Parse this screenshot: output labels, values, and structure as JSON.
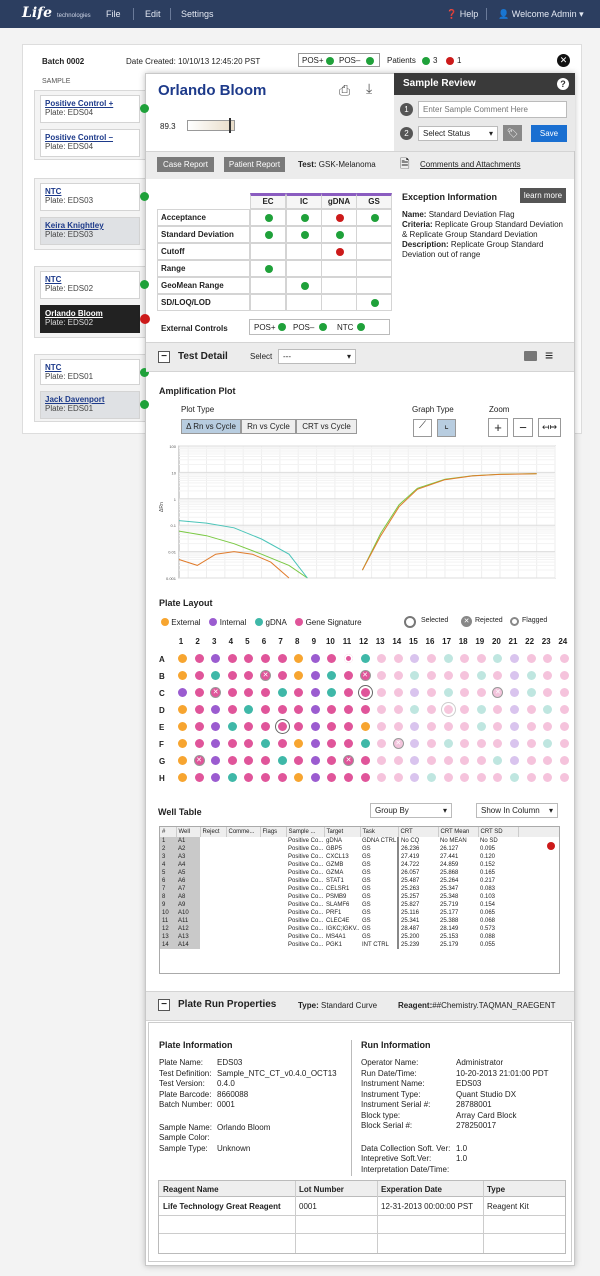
{
  "topbar": {
    "logo": "Life",
    "logo_small": "technologies",
    "menu": [
      "File",
      "Edit",
      "Settings"
    ],
    "help": "Help",
    "user": "Welcome Admin"
  },
  "batch": {
    "title": "Batch 0002",
    "date": "Date Created: 10/10/13 12:45:20 PST",
    "pos_plus": "POS+",
    "pos_minus": "POS–",
    "patients_label": "Patients",
    "patients_green": "3",
    "patients_red": "1",
    "sample_label": "SAMPLE"
  },
  "samples": [
    {
      "name": "Positive Control +",
      "plate": "Plate: EDS04"
    },
    {
      "name": "Positive Control –",
      "plate": "Plate: EDS04"
    },
    {
      "name": "NTC",
      "plate": "Plate: EDS03"
    },
    {
      "name": "Keira Knightley",
      "plate": "Plate: EDS03"
    },
    {
      "name": "NTC",
      "plate": "Plate: EDS02"
    },
    {
      "name": "Orlando Bloom",
      "plate": "Plate: EDS02"
    },
    {
      "name": "NTC",
      "plate": "Plate: EDS01"
    },
    {
      "name": "Jack Davenport",
      "plate": "Plate: EDS01"
    }
  ],
  "patient": {
    "name": "Orlando Bloom",
    "score": "89.3",
    "score_level": 0.9,
    "case_report": "Case Report",
    "patient_report": "Patient Report",
    "test_label": "Test:",
    "test_value": "GSK-Melanoma",
    "comments": "Comments and Attachments"
  },
  "review": {
    "title": "Sample Review",
    "comment_placeholder": "Enter Sample Comment Here",
    "status": "Select Status",
    "save": "Save",
    "step1": "1",
    "step2": "2"
  },
  "qc": {
    "cols": [
      "EC",
      "IC",
      "gDNA",
      "GS"
    ],
    "rows": [
      "Acceptance",
      "Standard Deviation",
      "Cutoff",
      "Range",
      "GeoMean Range",
      "SD/LOQ/LOD"
    ],
    "dots": [
      [
        "g",
        "g",
        "r",
        "g"
      ],
      [
        "g",
        "g",
        "g",
        ""
      ],
      [
        "",
        "",
        "r",
        ""
      ],
      [
        "g",
        "",
        "",
        ""
      ],
      [
        "",
        "g",
        "",
        ""
      ],
      [
        "",
        "",
        "",
        "g"
      ]
    ],
    "external_label": "External Controls",
    "ext": [
      "POS+",
      "POS–",
      "NTC"
    ]
  },
  "exception": {
    "title": "Exception Information",
    "learn": "learn more",
    "name_k": "Name:",
    "name_v": "Standard Deviation Flag",
    "criteria_k": "Criteria:",
    "criteria_v": "Replicate Group Standard Deviation & Replicate Group Standard Deviation",
    "desc_k": "Description:",
    "desc_v": "Replicate Group Standard Deviation out of range"
  },
  "test_detail": {
    "title": "Test Detail",
    "select_label": "Select",
    "select_value": "---"
  },
  "amp": {
    "title": "Amplification Plot",
    "plot_type": "Plot Type",
    "types": [
      "Δ Rn vs Cycle",
      "Rn vs Cycle",
      "CRT vs Cycle"
    ],
    "graph_type": "Graph Type",
    "zoom": "Zoom",
    "ylabel": "ΔRn",
    "yticks": [
      "100",
      "10",
      "1",
      "0.1",
      "0.01",
      "0.001"
    ]
  },
  "chart_data": {
    "type": "line",
    "title": "",
    "xlabel": "",
    "ylabel": "ΔRn",
    "yscale": "log",
    "ylim": [
      0.001,
      100
    ],
    "series": [
      {
        "color": "#e07b2b",
        "x": [
          1,
          3,
          5,
          7,
          9,
          11,
          13
        ],
        "y": [
          0.005,
          0.003,
          0.008,
          0.01,
          0.008,
          0.004,
          0.001
        ]
      },
      {
        "color": "#7ac943",
        "x": [
          1,
          4,
          7,
          10,
          13,
          15
        ],
        "y": [
          0.06,
          0.04,
          0.02,
          0.008,
          0.003,
          0.001
        ]
      },
      {
        "color": "#4ac4b8",
        "x": [
          1,
          4,
          7,
          10,
          13,
          15
        ],
        "y": [
          0.15,
          0.12,
          0.08,
          0.03,
          0.008,
          0.001
        ]
      },
      {
        "color": "#7ac943",
        "x": [
          21,
          23,
          25,
          27,
          30,
          33,
          36,
          40
        ],
        "y": [
          0.002,
          0.05,
          0.6,
          2.5,
          5.5,
          7.5,
          8.5,
          9
        ]
      },
      {
        "color": "#e07b2b",
        "x": [
          21,
          23,
          25,
          27,
          30,
          33,
          36,
          40
        ],
        "y": [
          0.002,
          0.04,
          0.5,
          2.3,
          5.3,
          7.4,
          8.4,
          8.9
        ]
      }
    ]
  },
  "plate": {
    "title": "Plate Layout",
    "legend": [
      "External",
      "Internal",
      "gDNA",
      "Gene Signature"
    ],
    "legend2": [
      "Selected",
      "Rejected",
      "Flagged"
    ],
    "cols": [
      "1",
      "2",
      "3",
      "4",
      "5",
      "6",
      "7",
      "8",
      "9",
      "10",
      "11",
      "12",
      "13",
      "14",
      "15",
      "16",
      "17",
      "18",
      "19",
      "20",
      "21",
      "22",
      "23",
      "24"
    ],
    "rows": [
      "A",
      "B",
      "C",
      "D",
      "E",
      "F",
      "G",
      "H"
    ],
    "grid": [
      "OPPPPPPOPPRTPPPPTPPTPPPP",
      "OPGPPXPOPGPXPPTPPPTPPTPP",
      "GPXPPPGPPGPSPPPPTPPXPTPP",
      "OPPPGPPPPPPPPPGPFPGPPPTP",
      "OPPGPPSPPPPOPPPPPPGPPPPP",
      "OPPPPGPOPPPGPXPPGPPPPPTP",
      "OXPPPPGPPPXPPPPPPPPGPPPP",
      "OPPGPPPOPPPPPPPGPPPPTPPP"
    ]
  },
  "well_table": {
    "title": "Well Table",
    "group_by": "Group By",
    "show": "Show In Column",
    "headers": [
      "#",
      "Well",
      "Reject",
      "Comme...",
      "Flags",
      "Sample ...",
      "Target",
      "Task",
      "CRT",
      "CRT Mean",
      "CRT SD"
    ],
    "rows": [
      [
        "1",
        "A1",
        "",
        "",
        "",
        "Positive Co...",
        "gDNA",
        "GDNA CTRL",
        "No CQ",
        "No MEAN",
        "No SD"
      ],
      [
        "2",
        "A2",
        "",
        "",
        "",
        "Positive Co...",
        "GBP5",
        "GS",
        "26.236",
        "26.127",
        "0.095"
      ],
      [
        "3",
        "A3",
        "",
        "",
        "",
        "Positive Co...",
        "CXCL13",
        "GS",
        "27.419",
        "27.441",
        "0.120"
      ],
      [
        "4",
        "A4",
        "",
        "",
        "",
        "Positive Co...",
        "GZMB",
        "GS",
        "24.722",
        "24.859",
        "0.152"
      ],
      [
        "5",
        "A5",
        "",
        "",
        "",
        "Positive Co...",
        "GZMA",
        "GS",
        "26.057",
        "25.868",
        "0.165"
      ],
      [
        "6",
        "A6",
        "",
        "",
        "",
        "Positive Co...",
        "STAT1",
        "GS",
        "25.487",
        "25.264",
        "0.217"
      ],
      [
        "7",
        "A7",
        "",
        "",
        "",
        "Positive Co...",
        "CELSR1",
        "GS",
        "25.263",
        "25.347",
        "0.083"
      ],
      [
        "8",
        "A8",
        "",
        "",
        "",
        "Positive Co...",
        "PSMB9",
        "GS",
        "25.257",
        "25.348",
        "0.103"
      ],
      [
        "9",
        "A9",
        "",
        "",
        "",
        "Positive Co...",
        "SLAMF6",
        "GS",
        "25.827",
        "25.719",
        "0.154"
      ],
      [
        "10",
        "A10",
        "",
        "",
        "",
        "Positive Co...",
        "PRF1",
        "GS",
        "25.116",
        "25.177",
        "0.065"
      ],
      [
        "11",
        "A11",
        "",
        "",
        "",
        "Positive Co...",
        "CLEC4E",
        "GS",
        "25.341",
        "25.388",
        "0.068"
      ],
      [
        "12",
        "A12",
        "",
        "",
        "",
        "Positive Co...",
        "IGKC;IGKV...",
        "GS",
        "28.487",
        "28.149",
        "0.573"
      ],
      [
        "13",
        "A13",
        "",
        "",
        "",
        "Positive Co...",
        "MS4A1",
        "GS",
        "25.200",
        "25.153",
        "0.088"
      ],
      [
        "14",
        "A14",
        "",
        "",
        "",
        "Positive Co...",
        "PGK1",
        "INT CTRL",
        "25.239",
        "25.179",
        "0.055"
      ]
    ]
  },
  "plate_run": {
    "title": "Plate Run Properties",
    "type_k": "Type:",
    "type_v": "Standard Curve",
    "reagent_k": "Reagent:",
    "reagent_v": "##Chemistry.TAQMAN_RAEGENT"
  },
  "plate_info": {
    "title": "Plate Information",
    "items": [
      [
        "Plate Name:",
        "EDS03"
      ],
      [
        "Test Definition:",
        "Sample_NTC_CT_v0.4.0_OCT13"
      ],
      [
        "Test Version:",
        "0.4.0"
      ],
      [
        "Plate Barcode:",
        "8660088"
      ],
      [
        "Batch Number:",
        "0001"
      ]
    ],
    "items2": [
      [
        "Sample Name:",
        "Orlando Bloom"
      ],
      [
        "Sample Color:",
        ""
      ],
      [
        "Sample Type:",
        "Unknown"
      ]
    ]
  },
  "run_info": {
    "title": "Run Information",
    "items": [
      [
        "Operator Name:",
        "Administrator"
      ],
      [
        "Run Date/Time:",
        "10-20-2013 21:01:00 PDT"
      ],
      [
        "Instrument Name:",
        "EDS03"
      ],
      [
        "Instrument Type:",
        "Quant Studio DX"
      ],
      [
        "Instrument Serial #:",
        "28788001"
      ],
      [
        "Block type:",
        "Array Card Block"
      ],
      [
        "Block Serial #:",
        "278250017"
      ]
    ],
    "items2": [
      [
        "Data Collection Soft. Ver:",
        "1.0"
      ],
      [
        "Intepretive Soft.Ver:",
        "1.0"
      ],
      [
        "Interpretation Date/Time:",
        ""
      ]
    ]
  },
  "reagent_table": {
    "headers": [
      "Reagent Name",
      "Lot Number",
      "Experation Date",
      "Type"
    ],
    "row": [
      "Life Technology Great Reagent",
      "0001",
      "12-31-2013 00:00:00 PST",
      "Reagent Kit"
    ]
  }
}
